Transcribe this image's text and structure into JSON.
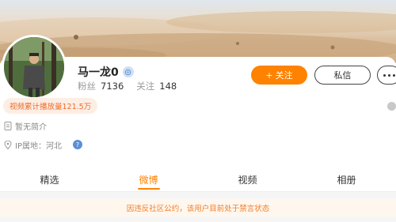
{
  "profile": {
    "username": "马一龙0",
    "stats": [
      {
        "label": "粉丝",
        "value": "7136"
      },
      {
        "label": "关注",
        "value": "148"
      }
    ],
    "play_count_badge": "视频累计播放量121.5万",
    "bio": "暂无简介",
    "ip_location": "IP属地：河北"
  },
  "actions": {
    "follow_label": "关注",
    "follow_plus": "+",
    "message_label": "私信"
  },
  "tabs": [
    {
      "label": "精选",
      "active": false
    },
    {
      "label": "微博",
      "active": true
    },
    {
      "label": "视频",
      "active": false
    },
    {
      "label": "相册",
      "active": false
    }
  ],
  "notice": "因违反社区公约，该用户目前处于禁言状态",
  "colors": {
    "accent": "#ff8200",
    "badge_text": "#f06a2a",
    "badge_bg": "#fdeee4",
    "help_icon": "#5a8fd8"
  },
  "icons": {
    "verified": "verified-icon",
    "bio": "document-icon",
    "ip": "location-icon",
    "help": "help-icon",
    "more": "more-icon"
  }
}
